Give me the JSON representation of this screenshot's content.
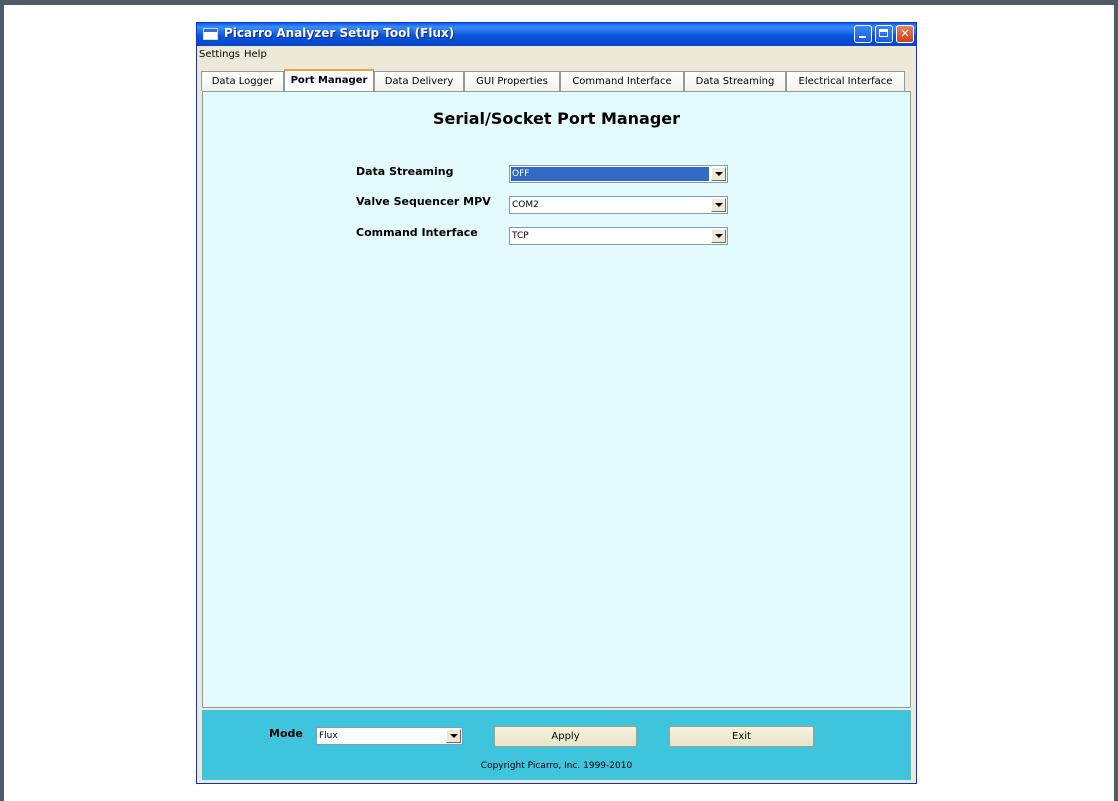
{
  "window": {
    "title": "Picarro Analyzer Setup Tool (Flux)"
  },
  "menubar": {
    "items": [
      "Settings",
      "Help"
    ]
  },
  "tabs": [
    {
      "label": "Data Logger",
      "active": false
    },
    {
      "label": "Port Manager",
      "active": true
    },
    {
      "label": "Data Delivery",
      "active": false
    },
    {
      "label": "GUI Properties",
      "active": false
    },
    {
      "label": "Command Interface",
      "active": false
    },
    {
      "label": "Data Streaming",
      "active": false
    },
    {
      "label": "Electrical Interface",
      "active": false
    }
  ],
  "panel": {
    "title": "Serial/Socket Port Manager",
    "fields": [
      {
        "label": "Data Streaming",
        "value": "OFF",
        "selected": true
      },
      {
        "label": "Valve Sequencer MPV",
        "value": "COM2",
        "selected": false
      },
      {
        "label": "Command Interface",
        "value": "TCP",
        "selected": false
      }
    ]
  },
  "bottom": {
    "mode_label": "Mode",
    "mode_value": "Flux",
    "apply_label": "Apply",
    "exit_label": "Exit",
    "copyright": "Copyright Picarro, Inc. 1999-2010"
  },
  "colors": {
    "panel_bg": "#e3fbfc",
    "bottom_bar_bg": "#3fc4dd",
    "selection": "#316ac5",
    "title_bar": "#0a55dd"
  }
}
